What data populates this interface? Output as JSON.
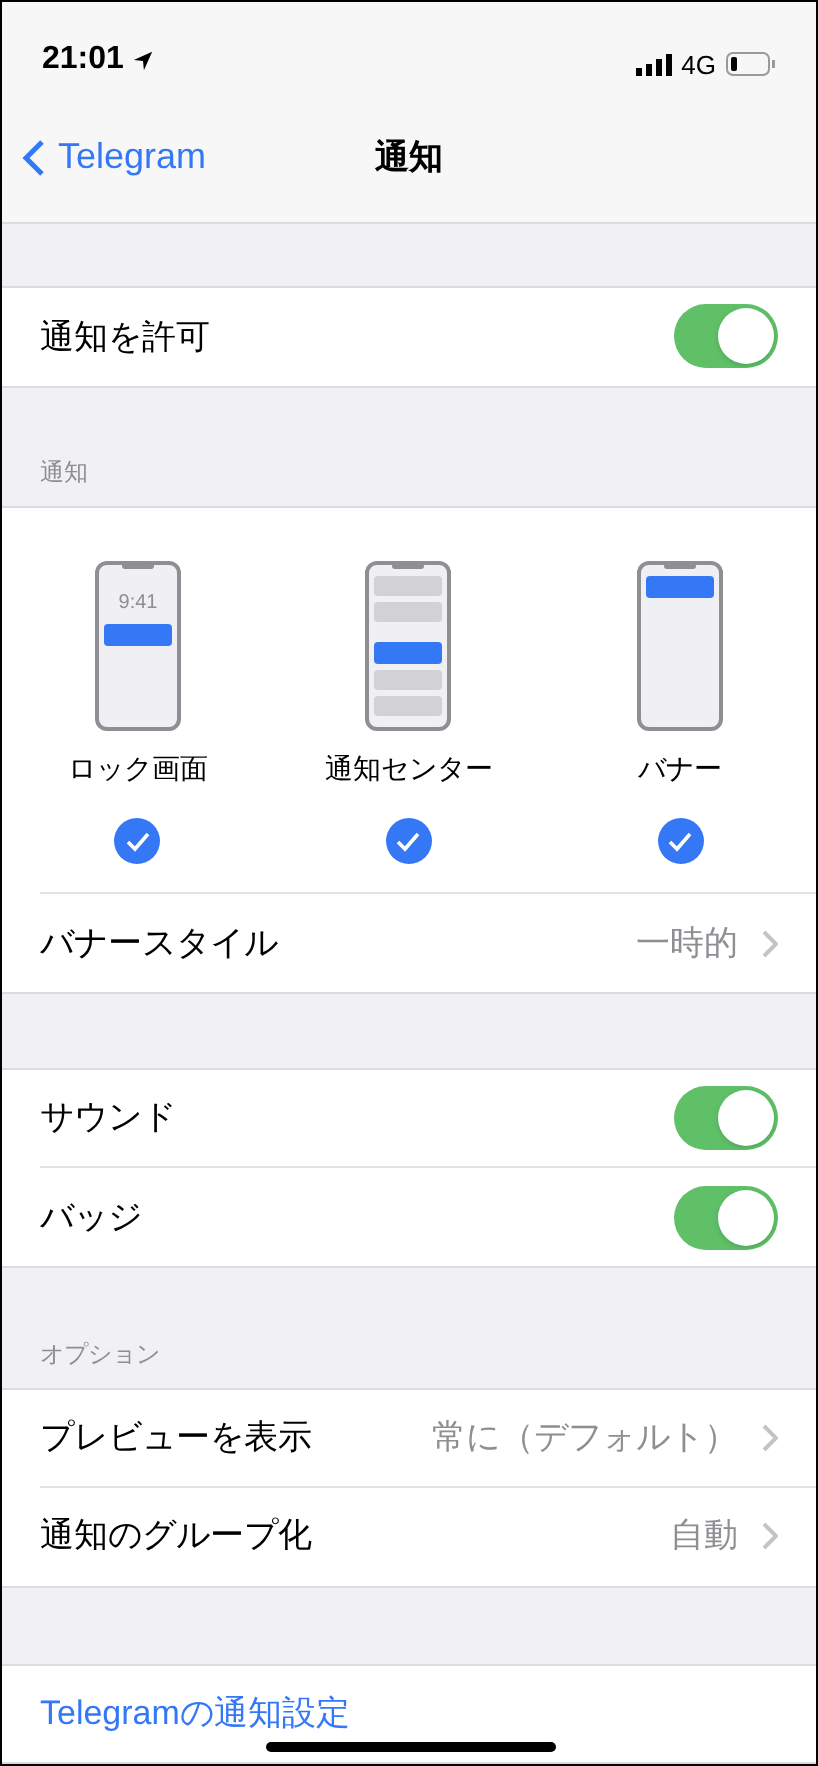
{
  "status_bar": {
    "time": "21:01",
    "network": "4G"
  },
  "nav": {
    "back": "Telegram",
    "title": "通知"
  },
  "allow": {
    "label": "通知を許可",
    "on": true
  },
  "alerts": {
    "header": "通知",
    "styles": [
      {
        "kind": "lock",
        "label": "ロック画面",
        "clock": "9:41",
        "checked": true
      },
      {
        "kind": "center",
        "label": "通知センター",
        "checked": true
      },
      {
        "kind": "banner",
        "label": "バナー",
        "checked": true
      }
    ],
    "banner_style": {
      "label": "バナースタイル",
      "value": "一時的"
    }
  },
  "sounds": [
    {
      "kind": "toggle",
      "label": "サウンド",
      "on": true
    },
    {
      "kind": "toggle",
      "label": "バッジ",
      "on": true
    }
  ],
  "options": {
    "header": "オプション",
    "rows": [
      {
        "kind": "disclosure",
        "label": "プレビューを表示",
        "value": "常に（デフォルト）"
      },
      {
        "kind": "disclosure",
        "label": "通知のグループ化",
        "value": "自動"
      }
    ]
  },
  "link": "Telegramの通知設定"
}
